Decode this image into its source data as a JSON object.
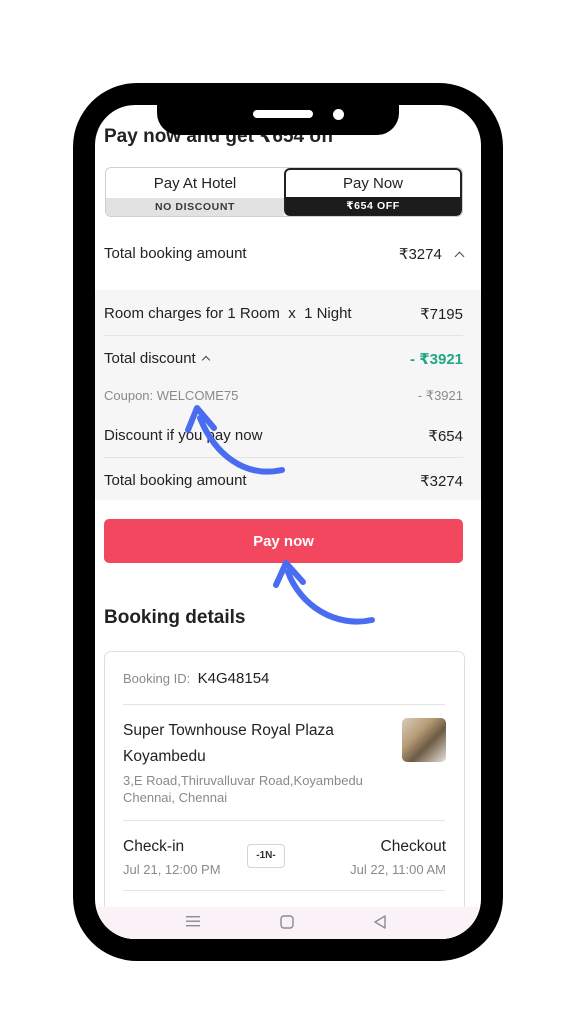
{
  "header": {
    "headline": "Pay now and get ₹654 off"
  },
  "payment_toggle": {
    "pay_at_hotel": {
      "label": "Pay At Hotel",
      "sub": "NO DISCOUNT"
    },
    "pay_now": {
      "label": "Pay Now",
      "sub": "₹654 OFF"
    },
    "selected": "pay_now"
  },
  "summary": {
    "label": "Total booking amount",
    "value": "₹3274"
  },
  "breakdown": {
    "room_charges": {
      "label": "Room charges for 1 Room  x  1 Night",
      "value": "₹7195"
    },
    "total_discount": {
      "label": "Total discount",
      "value": "- ₹3921"
    },
    "coupon": {
      "label": "Coupon: WELCOME75",
      "value": "- ₹3921"
    },
    "pay_now_discount": {
      "label": "Discount if you pay now",
      "value": "₹654"
    },
    "total": {
      "label": "Total booking amount",
      "value": "₹3274"
    }
  },
  "pay_button": {
    "label": "Pay now"
  },
  "booking_details": {
    "title": "Booking details",
    "booking_id_label": "Booking ID:",
    "booking_id": "K4G48154",
    "hotel_name": "Super Townhouse Royal Plaza Koyambedu",
    "address": "3,E Road,Thiruvalluvar Road,Koyambedu Chennai, Chennai",
    "checkin": {
      "label": "Check-in",
      "value": "Jul 21, 12:00 PM"
    },
    "nights": "-1N-",
    "checkout": {
      "label": "Checkout",
      "value": "Jul 22, 11:00 AM"
    }
  },
  "colors": {
    "accent": "#f2475e",
    "discount_green": "#1fa784",
    "annotation_arrow": "#4a6cf0"
  },
  "nav_icons": [
    "menu-icon",
    "home-square-icon",
    "back-triangle-icon"
  ]
}
